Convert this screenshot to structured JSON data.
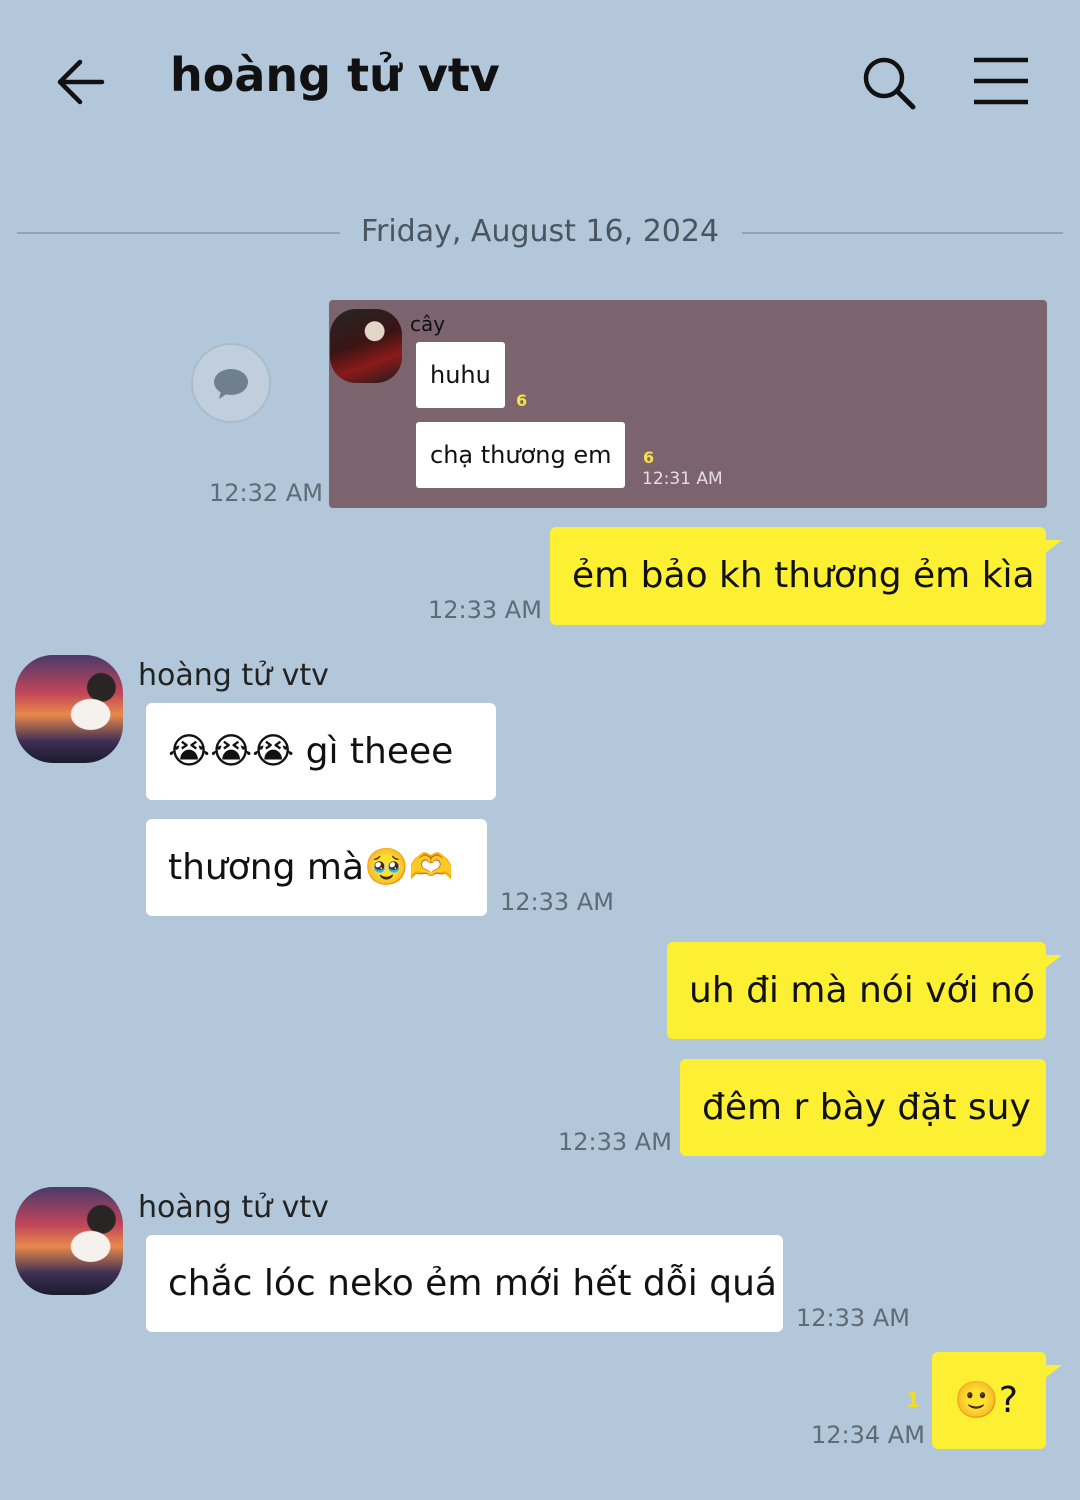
{
  "header": {
    "title": "hoàng tử vtv",
    "back_icon": "back-arrow-icon",
    "search_icon": "search-icon",
    "menu_icon": "menu-icon"
  },
  "date_divider": "Friday, August 16, 2024",
  "forwarded": {
    "sender": "cây",
    "messages": [
      {
        "text": "huhu",
        "count": "6"
      },
      {
        "text": "chạ thương em",
        "count": "6"
      }
    ],
    "inner_time": "12:31 AM",
    "outer_time": "12:32 AM"
  },
  "messages": {
    "m1": {
      "text": "ẻm bảo kh thương ẻm kìa",
      "time": "12:33 AM"
    },
    "g1": {
      "sender": "hoàng tử vtv",
      "line1": "😭😭😭 gì theee",
      "line2": "thương mà🥹🫶",
      "time": "12:33 AM"
    },
    "m2": {
      "line1": "uh đi mà nói với nó",
      "line2": "đêm r bày đặt suy",
      "time": "12:33 AM"
    },
    "g2": {
      "sender": "hoàng tử vtv",
      "text": "chắc lóc neko ẻm mới hết dỗi quá",
      "time": "12:33 AM"
    },
    "m3": {
      "text": "🙂?",
      "unread": "1",
      "time": "12:34 AM"
    }
  },
  "colors": {
    "background": "#b2c7d9",
    "my_bubble": "#fdf032",
    "their_bubble": "#ffffff",
    "forward_card": "#7b646e"
  }
}
